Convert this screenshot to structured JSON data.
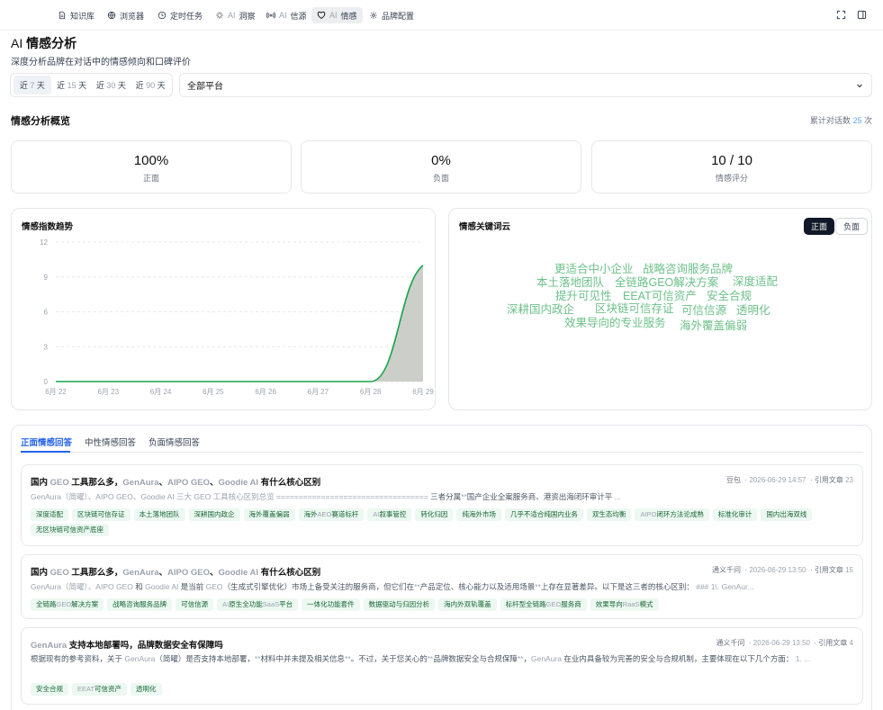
{
  "nav": {
    "tabs": [
      {
        "label": "知识库",
        "icon": "document-icon"
      },
      {
        "label": "浏览器",
        "icon": "globe-icon"
      },
      {
        "label": "定时任务",
        "icon": "clock-icon"
      },
      {
        "prefix": "AI",
        "label": "洞察",
        "icon": "sparkle-icon"
      },
      {
        "prefix": "AI",
        "label": "信源",
        "icon": "radio-icon"
      },
      {
        "prefix": "AI",
        "label": "情感",
        "icon": "heart-icon",
        "active": true
      },
      {
        "label": "品牌配置",
        "icon": "gear-icon"
      }
    ]
  },
  "header": {
    "title_prefix": "AI",
    "title": "情感分析",
    "subtitle": "深度分析品牌在对话中的情感倾向和口碑评价"
  },
  "filters": {
    "ranges": [
      {
        "pre": "近",
        "num": "7",
        "post": "天",
        "active": true
      },
      {
        "pre": "近",
        "num": "15",
        "post": "天"
      },
      {
        "pre": "近",
        "num": "30",
        "post": "天"
      },
      {
        "pre": "近",
        "num": "90",
        "post": "天"
      }
    ],
    "platform": "全部平台"
  },
  "overview": {
    "title": "情感分析概览",
    "total_label": "累计对话数",
    "total_value": "25",
    "total_unit": "次",
    "stats": [
      {
        "value": "100%",
        "label": "正面"
      },
      {
        "value": "0%",
        "label": "负面"
      },
      {
        "value": "10 / 10",
        "label": "情感评分"
      }
    ]
  },
  "chart_data": {
    "type": "area",
    "title": "情感指数趋势",
    "x": [
      "6月 22",
      "6月 23",
      "6月 24",
      "6月 25",
      "6月 26",
      "6月 27",
      "6月 28",
      "6月 29"
    ],
    "y_ticks": [
      "0",
      "3",
      "6",
      "9",
      "12"
    ],
    "ylim": [
      0,
      12
    ],
    "series": [
      {
        "values": [
          0,
          0,
          0,
          0,
          0,
          0,
          0,
          10
        ]
      }
    ],
    "line_color": "#16a34a",
    "fill_color": "#c9cbc6",
    "grid": true
  },
  "wordcloud": {
    "title": "情感关键词云",
    "toggle_positive": "正面",
    "toggle_negative": "负面",
    "color": "#6cc089",
    "words": [
      "更适合中小企业",
      "战略咨询服务品牌",
      "本土落地团队",
      "全链路GEO解决方案",
      "深度适配",
      "提升可见性",
      "EEAT可信资产",
      "安全合规",
      "深耕国内政企",
      "区块链可信存证",
      "可信信源",
      "透明化",
      "效果导向的专业服务",
      "海外覆盖偏弱"
    ]
  },
  "answers": {
    "tabs": [
      "正面情感回答",
      "中性情感回答",
      "负面情感回答"
    ],
    "cite_label": "引用文章",
    "cards": [
      {
        "title": [
          [
            "国内 ",
            0
          ],
          [
            "GEO",
            1
          ],
          [
            " 工具那么多，",
            0
          ],
          [
            "GenAura",
            1
          ],
          [
            "、",
            0
          ],
          [
            "AIPO GEO",
            1
          ],
          [
            "、",
            0
          ],
          [
            "Goodie AI",
            1
          ],
          [
            " 有什么核心区别",
            0
          ]
        ],
        "source": "豆包",
        "time": "2026-06-29 14:57",
        "cites": "23",
        "snippet": [
          [
            "GenAura（简曜）、AIPO GEO、Goodie AI 三大 GEO 工具核心区别总览 ==================================",
            1
          ],
          [
            " 三者分属",
            0
          ],
          [
            "**",
            1
          ],
          [
            "国产企业全案服务商、港资出海闭环审计平",
            0
          ],
          [
            " ...",
            1
          ]
        ],
        "tags": [
          [
            [
              "深度适配",
              0
            ]
          ],
          [
            [
              "区块链可信存证",
              0
            ]
          ],
          [
            [
              "本土落地团队",
              0
            ]
          ],
          [
            [
              "深耕国内政企",
              0
            ]
          ],
          [
            [
              "海外覆盖偏弱",
              0
            ]
          ],
          [
            [
              "海外",
              0
            ],
            [
              "AEO",
              1
            ],
            [
              "赛道标杆",
              0
            ]
          ],
          [
            [
              "AI",
              1
            ],
            [
              "叙事管控",
              0
            ]
          ],
          [
            [
              "转化归因",
              0
            ]
          ],
          [
            [
              "纯海外市场",
              0
            ]
          ],
          [
            [
              "几乎不适合纯国内业务",
              0
            ]
          ],
          [
            [
              "双生态均衡",
              0
            ]
          ],
          [
            [
              "AIPO",
              1
            ],
            [
              "闭环方法论成熟",
              0
            ]
          ],
          [
            [
              "标准化审计",
              0
            ]
          ],
          [
            [
              "国内出海双线",
              0
            ]
          ],
          [
            [
              "无区块链可信资产底座",
              0
            ]
          ]
        ]
      },
      {
        "title": [
          [
            "国内 ",
            0
          ],
          [
            "GEO",
            1
          ],
          [
            " 工具那么多，",
            0
          ],
          [
            "GenAura",
            1
          ],
          [
            "、",
            0
          ],
          [
            "AIPO GEO",
            1
          ],
          [
            "、",
            0
          ],
          [
            "Goodie AI",
            1
          ],
          [
            " 有什么核心区别",
            0
          ]
        ],
        "source": "通义千问",
        "time": "2026-06-29 13:50",
        "cites": "15",
        "snippet": [
          [
            "GenAura（简曜）、AIPO GEO",
            1
          ],
          [
            " 和 ",
            0
          ],
          [
            "Goodie AI",
            1
          ],
          [
            " 是当前 ",
            0
          ],
          [
            "GEO",
            1
          ],
          [
            "（生成式引擎优化）市场上备受关注的服务商，但它们在",
            0
          ],
          [
            "**",
            1
          ],
          [
            "产品定位、核心能力以及适用场景",
            0
          ],
          [
            "**",
            1
          ],
          [
            "上存在显著差异。以下是这三者的核心区别：",
            0
          ],
          [
            " ### 1\\. GenAur...",
            1
          ]
        ],
        "tags": [
          [
            [
              "全链路",
              0
            ],
            [
              "GEO",
              1
            ],
            [
              "解决方案",
              0
            ]
          ],
          [
            [
              "战略咨询服务品牌",
              0
            ]
          ],
          [
            [
              "可信信源",
              0
            ]
          ],
          [
            [
              "AI",
              1
            ],
            [
              "原生全功能",
              0
            ],
            [
              "SaaS",
              1
            ],
            [
              "平台",
              0
            ]
          ],
          [
            [
              "一体化功能套件",
              0
            ]
          ],
          [
            [
              "数据驱动与归因分析",
              0
            ]
          ],
          [
            [
              "海内外双轨覆盖",
              0
            ]
          ],
          [
            [
              "标杆型全链路",
              0
            ],
            [
              "GEO",
              1
            ],
            [
              "服务商",
              0
            ]
          ],
          [
            [
              "效果导向",
              0
            ],
            [
              "RaaS",
              1
            ],
            [
              "模式",
              0
            ]
          ]
        ]
      },
      {
        "title": [
          [
            "GenAura",
            1
          ],
          [
            " 支持本地部署吗，品牌数据安全有保障吗",
            0
          ]
        ],
        "source": "通义千问",
        "time": "2026-06-29 13:50",
        "cites": "4",
        "snippet": [
          [
            "根据现有的参考资料，关于 ",
            0
          ],
          [
            "GenAura",
            1
          ],
          [
            "（简曜）是否支持本地部署，",
            0
          ],
          [
            "**",
            1
          ],
          [
            "材料中并未提及相关信息",
            0
          ],
          [
            "**",
            1
          ],
          [
            "。不过，关于您关心的",
            0
          ],
          [
            "**",
            1
          ],
          [
            "品牌数据安全与合规保障",
            0
          ],
          [
            "**",
            1
          ],
          [
            "，",
            0
          ],
          [
            "GenAura",
            1
          ],
          [
            " 在业内具备较为完善的安全与合规机制，主要体现在以下几个方面：",
            0
          ],
          [
            " 1. ...",
            1
          ]
        ],
        "tags": [
          [
            [
              "安全合规",
              0
            ]
          ],
          [
            [
              "EEAT",
              1
            ],
            [
              "可信资产",
              0
            ]
          ],
          [
            [
              "透明化",
              0
            ]
          ]
        ]
      }
    ]
  }
}
